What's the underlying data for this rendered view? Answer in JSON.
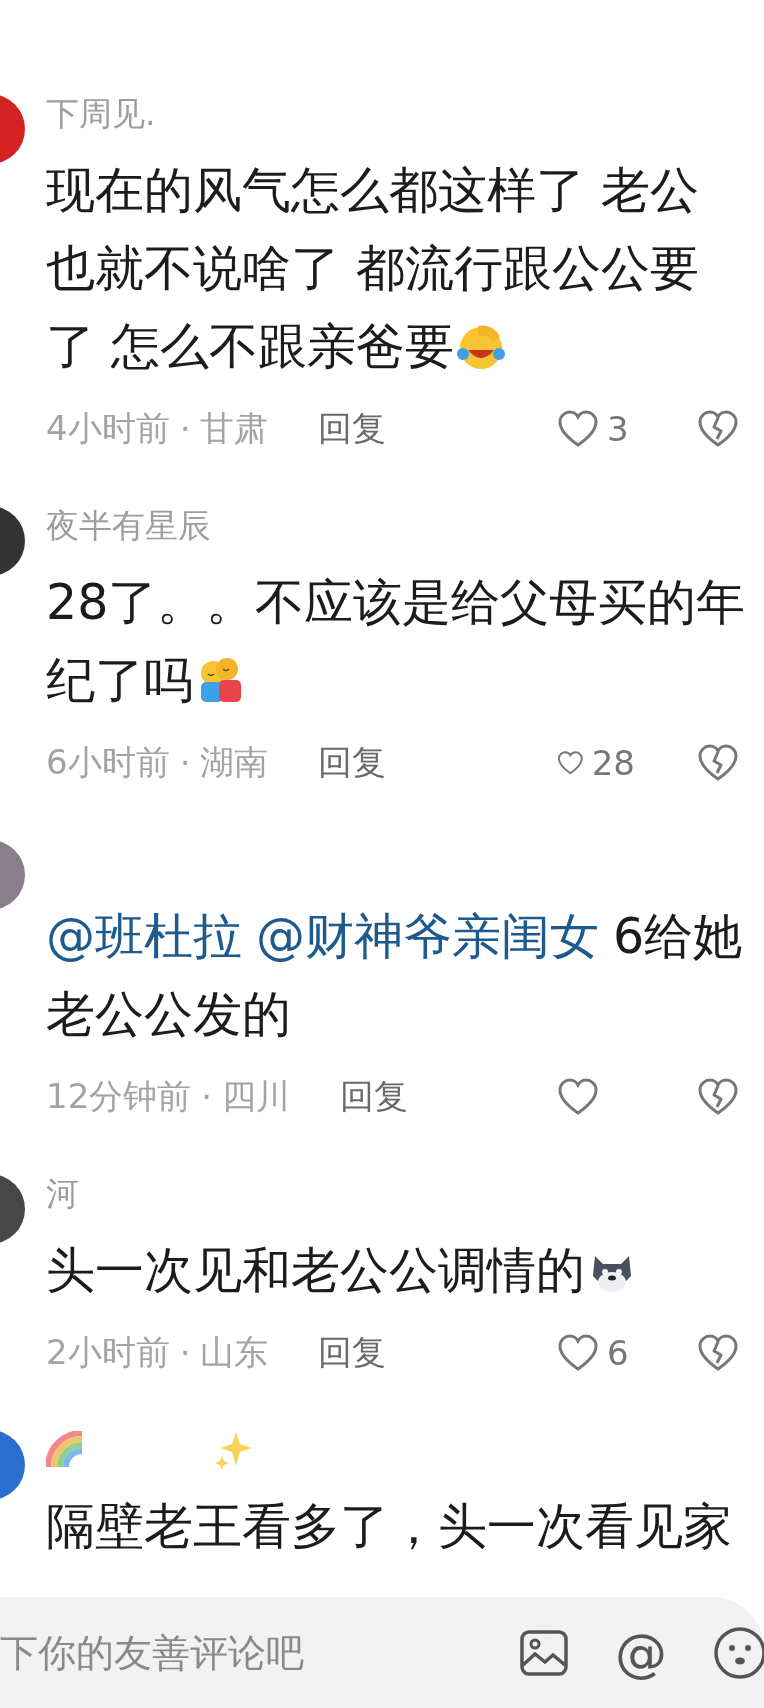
{
  "comments": [
    {
      "color": "#d42222",
      "name": "下周见.",
      "lines": [
        [
          {
            "kind": "text",
            "text": "现在的风气怎么都这样了 老公"
          }
        ],
        [
          {
            "kind": "text",
            "text": "也就不说啥了 都流行跟公公要"
          }
        ],
        [
          {
            "kind": "text",
            "text": "了 怎么不跟亲爸要"
          },
          {
            "kind": "sticker-laugh-cry"
          }
        ]
      ],
      "time": "4小时前",
      "location": "甘肃",
      "reply": "回复",
      "likes": "3"
    },
    {
      "color": "#333333",
      "name": "夜半有星辰",
      "lines": [
        [
          {
            "kind": "text",
            "text": "28了。。不应该是给父母买的年"
          }
        ],
        [
          {
            "kind": "text",
            "text": "纪了吗"
          },
          {
            "kind": "sticker-hug"
          }
        ]
      ],
      "time": "6小时前",
      "location": "湖南",
      "reply": "回复",
      "likes": "28"
    },
    {
      "color": "#8a7d8c",
      "lines": [
        [
          {
            "kind": "mention",
            "text": "@班杜拉"
          },
          {
            "kind": "mention",
            "text": "@财神爷亲闺女"
          },
          {
            "kind": "text",
            "text": "6给她"
          }
        ],
        [
          {
            "kind": "text",
            "text": "老公公发的"
          }
        ]
      ],
      "time": "12分钟前",
      "location": "四川",
      "reply": "回复"
    },
    {
      "color": "#474747",
      "name": "河",
      "lines": [
        [
          {
            "kind": "text",
            "text": "头一次见和老公公调情的"
          },
          {
            "kind": "sticker-wolf"
          }
        ]
      ],
      "time": "2小时前",
      "location": "山东",
      "reply": "回复",
      "likes": "6"
    },
    {
      "color": "#2a6fd0",
      "name_icons": [
        {
          "kind": "rainbow"
        },
        {
          "kind": "sparkles"
        }
      ],
      "lines": [
        [
          {
            "kind": "text",
            "text": "隔壁老王看多了，头一次看见家"
          }
        ]
      ]
    }
  ],
  "separator": "·",
  "composer": {
    "placeholder": "下你的友善评论吧",
    "mention_button": "@"
  }
}
